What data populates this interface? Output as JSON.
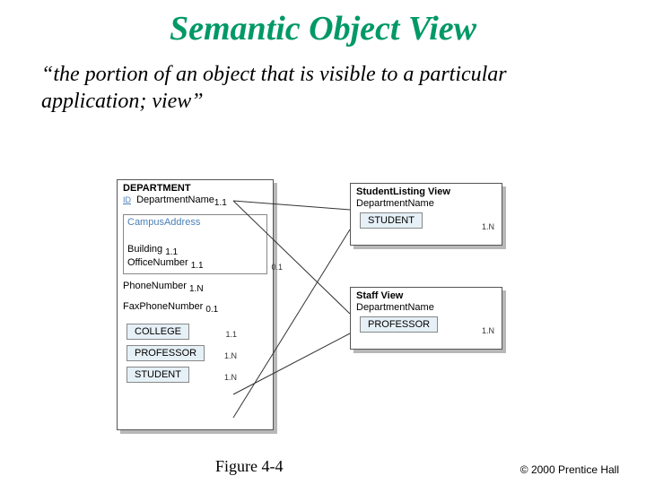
{
  "title": "Semantic Object View",
  "subtitle": "“the portion of an object that is visible to a particular application; view”",
  "figure_label": "Figure 4-4",
  "copyright": "© 2000 Prentice Hall",
  "department": {
    "header": "DEPARTMENT",
    "id_prefix": "ID",
    "name": "DepartmentName",
    "name_card": "1.1",
    "campus_group_label": "CampusAddress",
    "campus_group_card": "0.1",
    "building": "Building",
    "building_card": "1.1",
    "office": "OfficeNumber",
    "office_card": "1.1",
    "phone": "PhoneNumber",
    "phone_card": "1.N",
    "fax": "FaxPhoneNumber",
    "fax_card": "0.1",
    "college": "COLLEGE",
    "college_card": "1.1",
    "professor": "PROFESSOR",
    "professor_card": "1.N",
    "student": "STUDENT",
    "student_card": "1.N"
  },
  "student_view": {
    "header": "StudentListing View",
    "name": "DepartmentName",
    "student": "STUDENT",
    "card": "1.N"
  },
  "staff_view": {
    "header": "Staff View",
    "name": "DepartmentName",
    "professor": "PROFESSOR",
    "card": "1.N"
  }
}
